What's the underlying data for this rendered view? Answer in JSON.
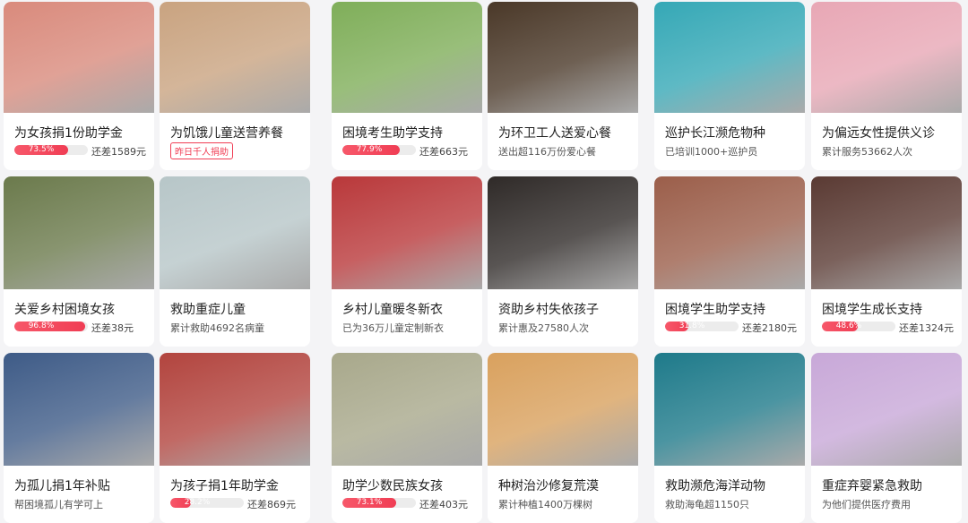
{
  "cards": [
    {
      "title": "为女孩捐1份助学金",
      "progress": {
        "label": "73.5%",
        "value": 0.735
      },
      "remaining": "还差1589元",
      "img": "#d98a7c"
    },
    {
      "title": "为饥饿儿童送营养餐",
      "tag": "昨日千人捐助",
      "img": "#c9a380"
    },
    {
      "title": "困境考生助学支持",
      "progress": {
        "label": "77.9%",
        "value": 0.779
      },
      "remaining": "还差663元",
      "img": "#7fae59"
    },
    {
      "title": "为环卫工人送爱心餐",
      "sub": "送出超116万份爱心餐",
      "img": "#4a3828"
    },
    {
      "title": "巡护长江濒危物种",
      "sub": "已培训1000+巡护员",
      "img": "#35a8b6"
    },
    {
      "title": "为偏远女性提供义诊",
      "sub": "累计服务53662人次",
      "img": "#e8a7b5"
    },
    {
      "title": "关爱乡村困境女孩",
      "progress": {
        "label": "96.8%",
        "value": 0.968
      },
      "remaining": "还差38元",
      "img": "#6b7a4c"
    },
    {
      "title": "救助重症儿童",
      "sub": "累计救助4692名病童",
      "img": "#b7c6c8"
    },
    {
      "title": "乡村儿童暖冬新衣",
      "sub": "已为36万儿童定制新衣",
      "img": "#b9383a"
    },
    {
      "title": "资助乡村失依孩子",
      "sub": "累计惠及27580人次",
      "img": "#2f2a28"
    },
    {
      "title": "困境学生助学支持",
      "progress": {
        "label": "31.8%",
        "value": 0.318
      },
      "remaining": "还差2180元",
      "img": "#9b5e4a"
    },
    {
      "title": "困境学生成长支持",
      "progress": {
        "label": "48.6%",
        "value": 0.486
      },
      "remaining": "还差1324元",
      "img": "#5a3a33"
    },
    {
      "title": "为孤儿捐1年补贴",
      "sub": "帮困境孤儿有学可上",
      "img": "#3e5b87"
    },
    {
      "title": "为孩子捐1年助学金",
      "progress": {
        "label": "28.2%",
        "value": 0.282
      },
      "remaining": "还差869元",
      "img": "#b2443e"
    },
    {
      "title": "助学少数民族女孩",
      "progress": {
        "label": "73.1%",
        "value": 0.731
      },
      "remaining": "还差403元",
      "img": "#a8a88b"
    },
    {
      "title": "种树治沙修复荒漠",
      "sub": "累计种植1400万棵树",
      "img": "#d9a15e"
    },
    {
      "title": "救助濒危海洋动物",
      "sub": "救助海龟超1150只",
      "img": "#1e7a8a"
    },
    {
      "title": "重症弃婴紧急救助",
      "sub": "为他们提供医疗费用",
      "img": "#c8a8d8"
    }
  ]
}
